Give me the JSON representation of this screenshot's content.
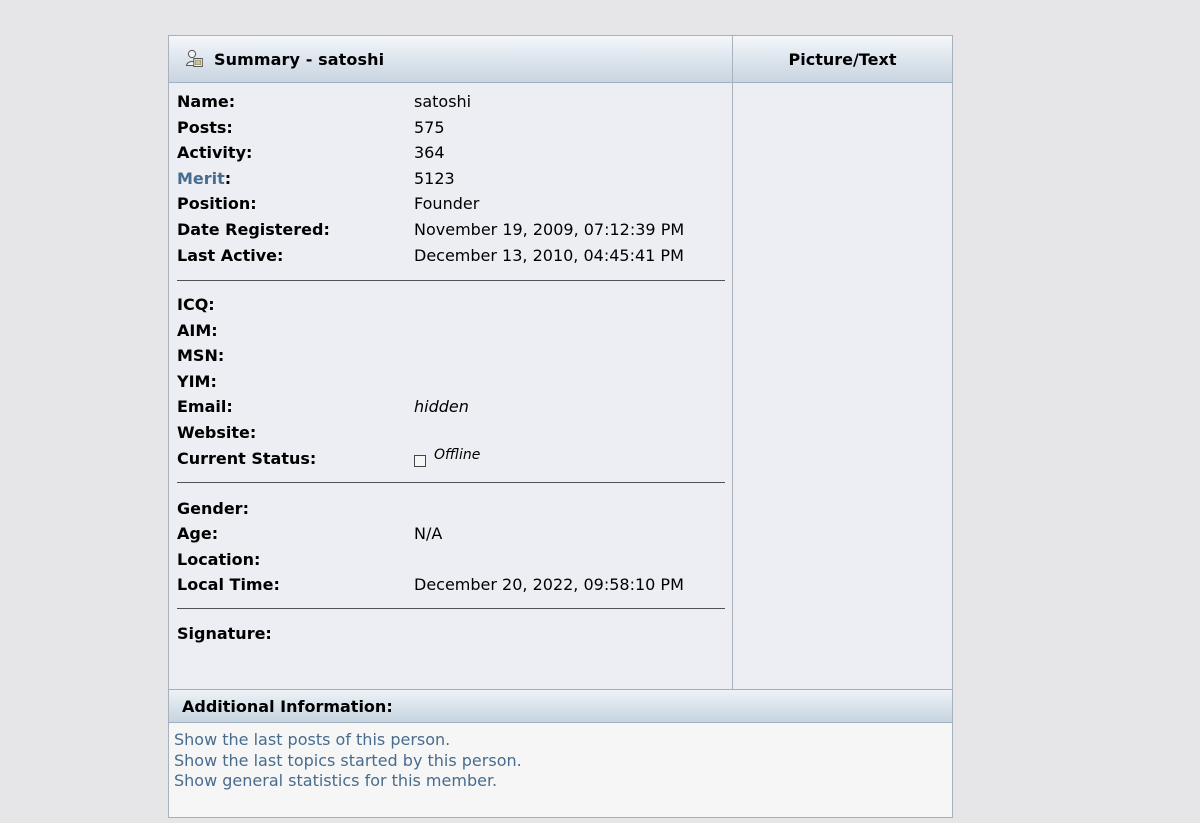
{
  "header": {
    "summary_title": "Summary - satoshi",
    "picture_title": "Picture/Text",
    "icon": "user-profile-icon"
  },
  "profile": {
    "name_label": "Name:",
    "name_value": "satoshi",
    "posts_label": "Posts:",
    "posts_value": "575",
    "activity_label": "Activity:",
    "activity_value": "364",
    "merit_link": "Merit",
    "merit_colon": ":",
    "merit_value": "5123",
    "position_label": "Position:",
    "position_value": "Founder",
    "date_registered_label": "Date Registered:",
    "date_registered_value": "November 19, 2009, 07:12:39 PM",
    "last_active_label": "Last Active:",
    "last_active_value": "December 13, 2010, 04:45:41 PM"
  },
  "contact": {
    "icq_label": "ICQ:",
    "aim_label": "AIM:",
    "msn_label": "MSN:",
    "yim_label": "YIM:",
    "email_label": "Email:",
    "email_value": "hidden",
    "website_label": "Website:",
    "current_status_label": "Current Status:",
    "current_status_value": "Offline"
  },
  "personal": {
    "gender_label": "Gender:",
    "age_label": "Age:",
    "age_value": "N/A",
    "location_label": "Location:",
    "local_time_label": "Local Time:",
    "local_time_value": "December 20, 2022, 09:58:10 PM"
  },
  "signature": {
    "label": "Signature:"
  },
  "additional": {
    "title": "Additional Information:",
    "links": [
      "Show the last posts of this person.",
      "Show the last topics started by this person.",
      "Show general statistics for this member."
    ]
  },
  "colors": {
    "link": "#476c8e",
    "page_background": "#e6e6e8",
    "panel_background": "#eceef3",
    "header_gradient_end": "#c9d5e1"
  }
}
